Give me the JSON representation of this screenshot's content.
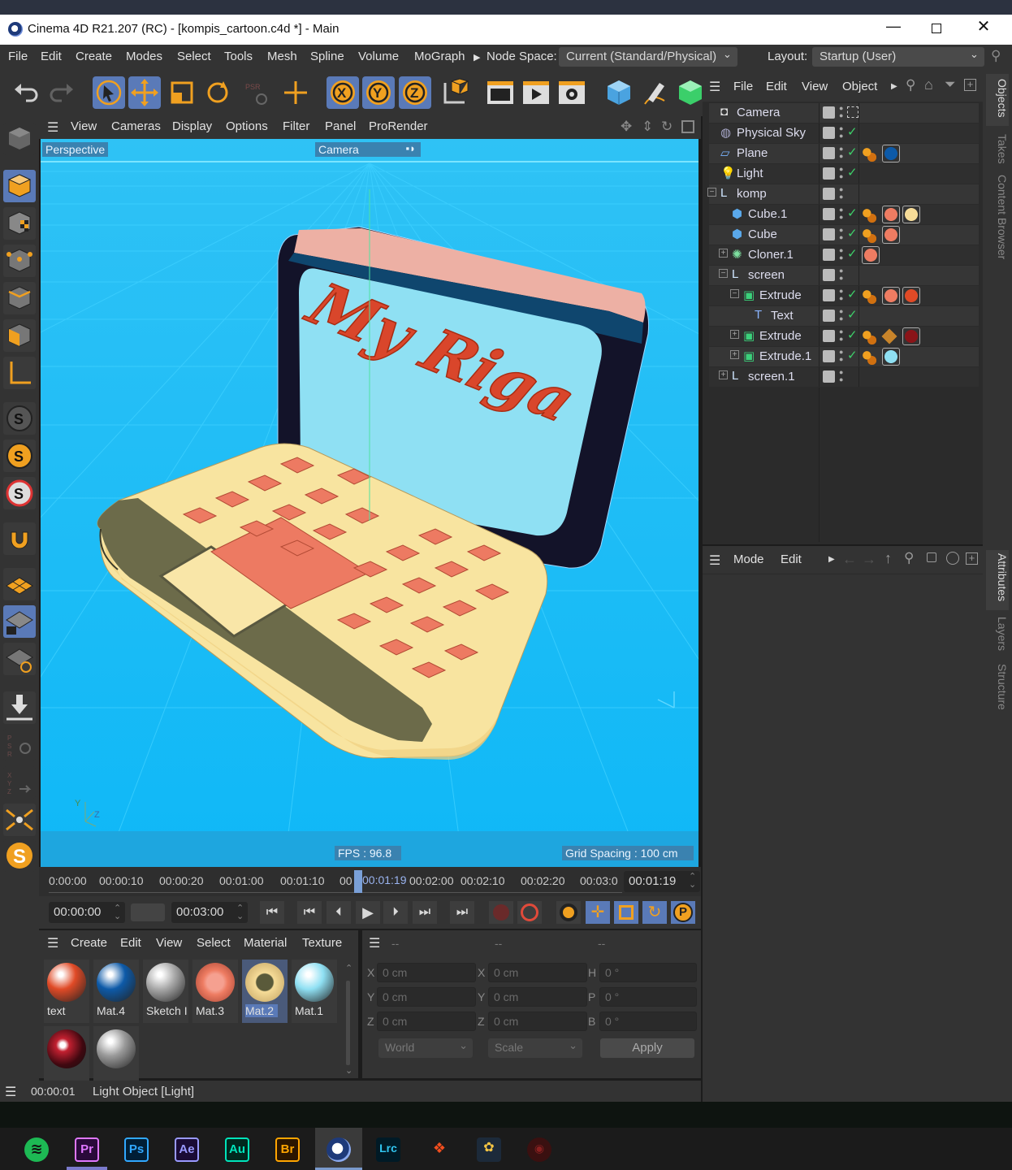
{
  "window": {
    "title": "Cinema 4D R21.207 (RC) - [kompis_cartoon.c4d *] - Main"
  },
  "menubar": {
    "items": [
      "File",
      "Edit",
      "Create",
      "Modes",
      "Select",
      "Tools",
      "Mesh",
      "Spline",
      "Volume",
      "MoGraph"
    ],
    "node_space_label": "Node Space:",
    "node_space_value": "Current (Standard/Physical)",
    "layout_label": "Layout:",
    "layout_value": "Startup (User)"
  },
  "viewport": {
    "menu": [
      "View",
      "Cameras",
      "Display",
      "Options",
      "Filter",
      "Panel",
      "ProRender"
    ],
    "view_name": "Perspective",
    "camera_name": "Camera",
    "fps": "FPS : 96.8",
    "grid_spacing": "Grid Spacing : 100 cm",
    "scene_text": "My Riga",
    "axes": {
      "y": "Y",
      "z": "Z",
      "x": "X"
    }
  },
  "timeline": {
    "ticks": [
      "0:00:00",
      "00:00:10",
      "00:00:20",
      "00:01:00",
      "00:01:10",
      "00",
      "00:01:19",
      "00:02:00",
      "00:02:10",
      "00:02:20",
      "00:03:0"
    ],
    "current": "00:01:19",
    "playhead_fraction": 0.5,
    "start": "00:00:00",
    "end": "00:03:00"
  },
  "materials": {
    "menu": [
      "Create",
      "Edit",
      "View",
      "Select",
      "Material",
      "Texture"
    ],
    "items": [
      {
        "name": "text",
        "color": "#e04a26"
      },
      {
        "name": "Mat.4",
        "color": "#0d5aa8"
      },
      {
        "name": "Sketch I",
        "color": "#a9a9a9"
      },
      {
        "name": "Mat.3",
        "color": "#ee7c62"
      },
      {
        "name": "Mat.2",
        "color": "#f6dc98"
      },
      {
        "name": "Mat.1",
        "color": "#8fe0f3"
      },
      {
        "name": "",
        "color": "#8a1418"
      },
      {
        "name": "",
        "color": "#9a9a9a"
      }
    ]
  },
  "coords": {
    "header": [
      "--",
      "--",
      "--"
    ],
    "pos": {
      "x": "0 cm",
      "y": "0 cm",
      "z": "0 cm"
    },
    "size": {
      "x": "0 cm",
      "y": "0 cm",
      "z": "0 cm"
    },
    "rot": {
      "h": "0 °",
      "p": "0 °",
      "b": "0 °"
    },
    "labels": {
      "x": "X",
      "y": "Y",
      "z": "Z",
      "h": "H",
      "p": "P",
      "b": "B"
    },
    "world": "World",
    "scale": "Scale",
    "apply": "Apply"
  },
  "status": {
    "time": "00:00:01",
    "text": "Light Object [Light]"
  },
  "objects": {
    "menu": [
      "File",
      "Edit",
      "View",
      "Object"
    ],
    "rows": [
      {
        "name": "Camera",
        "indent": 0,
        "icon": "camera-icon"
      },
      {
        "name": "Physical Sky",
        "indent": 0,
        "icon": "sky-icon"
      },
      {
        "name": "Plane",
        "indent": 0,
        "icon": "plane-icon"
      },
      {
        "name": "Light",
        "indent": 0,
        "icon": "light-icon"
      },
      {
        "name": "komp",
        "indent": 0,
        "icon": "null-icon"
      },
      {
        "name": "Cube.1",
        "indent": 1,
        "icon": "cube-icon"
      },
      {
        "name": "Cube",
        "indent": 1,
        "icon": "cube-icon"
      },
      {
        "name": "Cloner.1",
        "indent": 1,
        "icon": "cloner-icon"
      },
      {
        "name": "screen",
        "indent": 1,
        "icon": "null-icon"
      },
      {
        "name": "Extrude",
        "indent": 2,
        "icon": "extrude-icon"
      },
      {
        "name": "Text",
        "indent": 3,
        "icon": "text-icon"
      },
      {
        "name": "Extrude",
        "indent": 2,
        "icon": "extrude-icon"
      },
      {
        "name": "Extrude.1",
        "indent": 2,
        "icon": "extrude-icon"
      },
      {
        "name": "screen.1",
        "indent": 1,
        "icon": "null-icon"
      }
    ]
  },
  "attributes": {
    "menu": [
      "Mode",
      "Edit"
    ]
  },
  "side_tabs": {
    "top": [
      "Objects",
      "Takes",
      "Content Browser"
    ],
    "bottom": [
      "Attributes",
      "Layers",
      "Structure"
    ]
  },
  "taskbar": {
    "apps": [
      "spotify-icon",
      "Pr",
      "Ps",
      "Ae",
      "Au",
      "Br",
      "cinema4d-icon",
      "Lrc",
      "figma-icon",
      "davinci-icon",
      "other-icon"
    ]
  }
}
